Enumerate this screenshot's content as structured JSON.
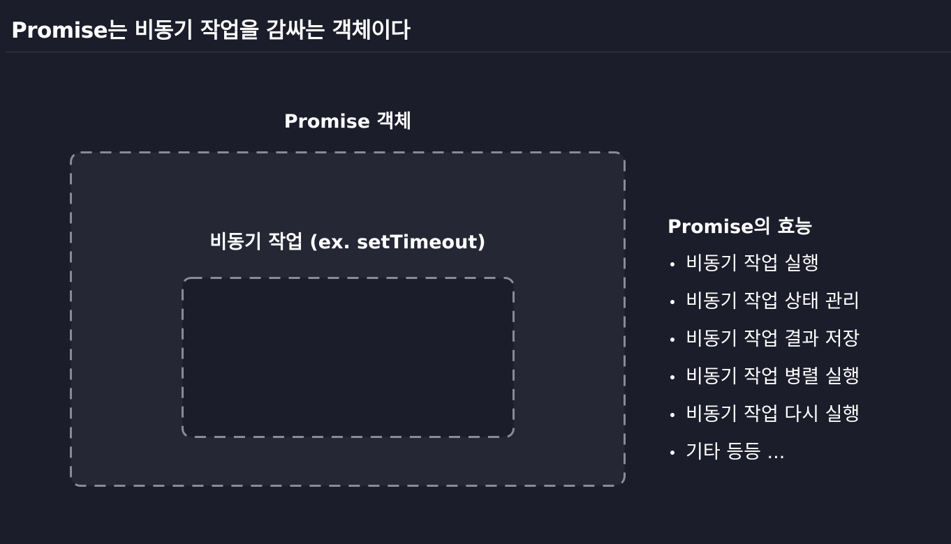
{
  "header": {
    "title": "Promise는 비동기 작업을 감싸는 객체이다"
  },
  "diagram": {
    "outer_label": "Promise 객체",
    "inner_label": "비동기 작업 (ex. setTimeout)",
    "colors": {
      "background": "#1c1d2a",
      "outer_fill": "#262735",
      "inner_fill": "#1c1d2a",
      "dash_stroke": "#8a8b93"
    }
  },
  "effects": {
    "title": "Promise의 효능",
    "items": [
      "비동기 작업 실행",
      "비동기 작업 상태 관리",
      "비동기 작업 결과 저장",
      "비동기 작업 병렬 실행",
      "비동기 작업 다시 실행",
      "기타 등등 ..."
    ]
  }
}
